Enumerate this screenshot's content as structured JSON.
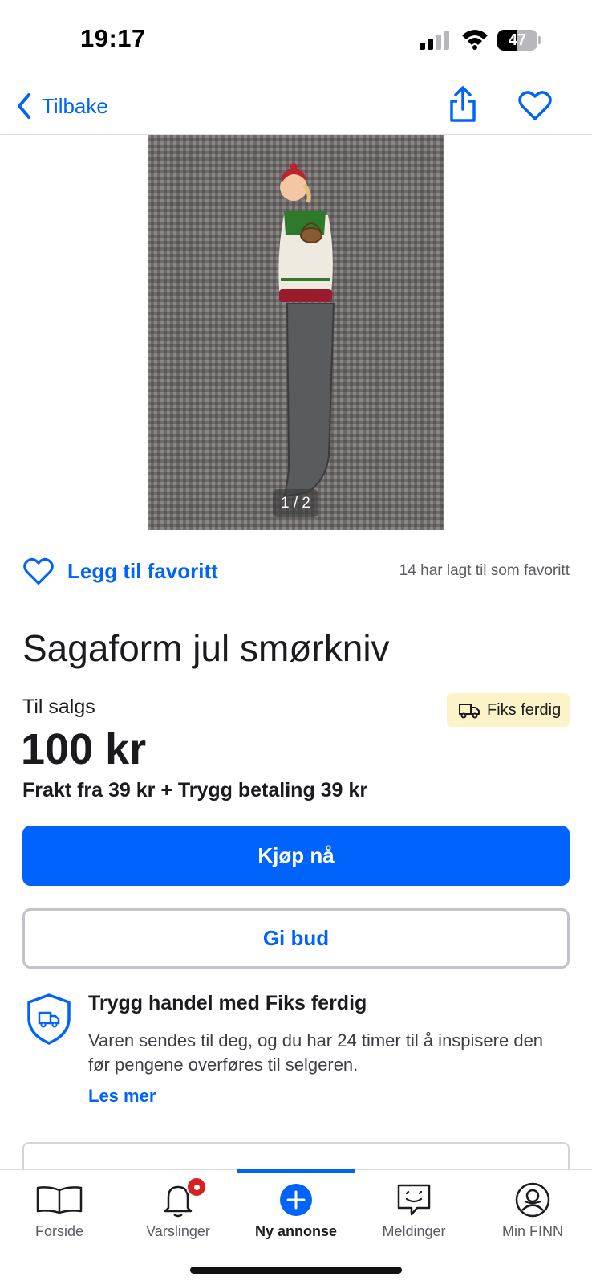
{
  "status_bar": {
    "time": "19:17",
    "battery_level": "47",
    "battery_fraction": 0.47
  },
  "nav": {
    "back_label": "Tilbake",
    "share_icon": "share-icon",
    "favorite_icon": "heart-icon"
  },
  "gallery": {
    "counter": "1 / 2"
  },
  "favorite": {
    "add_label": "Legg til favoritt",
    "count_text": "14 har lagt til som favoritt"
  },
  "listing": {
    "title": "Sagaform jul smørkniv",
    "sale_label": "Til salgs",
    "badge": "Fiks ferdig",
    "price": "100 kr",
    "shipping": "Frakt fra 39 kr + Trygg betaling 39 kr"
  },
  "actions": {
    "buy_label": "Kjøp nå",
    "bid_label": "Gi bud"
  },
  "safe_trade": {
    "title": "Trygg handel med Fiks ferdig",
    "text": "Varen sendes til deg, og du har 24 timer til å inspisere den før pengene overføres til selgeren.",
    "link": "Les mer"
  },
  "tabs": [
    {
      "label": "Forside",
      "icon": "book-icon"
    },
    {
      "label": "Varslinger",
      "icon": "bell-icon"
    },
    {
      "label": "Ny annonse",
      "icon": "plus-circle-icon",
      "active": true
    },
    {
      "label": "Meldinger",
      "icon": "chat-icon"
    },
    {
      "label": "Min FINN",
      "icon": "profile-icon"
    }
  ],
  "colors": {
    "accent": "#0063fb",
    "badge_bg": "#fdf3c8",
    "notification": "#d91f1f"
  }
}
